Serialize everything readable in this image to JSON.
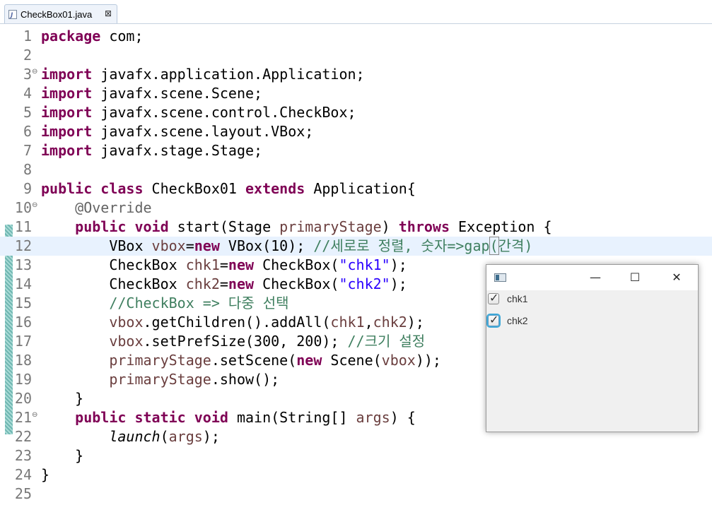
{
  "tab": {
    "title": "CheckBox01.java",
    "close": "⊠"
  },
  "editor": {
    "lines": [
      {
        "n": "1",
        "tokens": [
          {
            "t": "package",
            "c": "kw"
          },
          {
            "t": " com;"
          }
        ]
      },
      {
        "n": "2",
        "tokens": []
      },
      {
        "n": "3",
        "fold": "⊖",
        "tokens": [
          {
            "t": "import",
            "c": "kw"
          },
          {
            "t": " javafx.application.Application;"
          }
        ]
      },
      {
        "n": "4",
        "tokens": [
          {
            "t": "import",
            "c": "kw"
          },
          {
            "t": " javafx.scene.Scene;"
          }
        ]
      },
      {
        "n": "5",
        "tokens": [
          {
            "t": "import",
            "c": "kw"
          },
          {
            "t": " javafx.scene.control.CheckBox;"
          }
        ]
      },
      {
        "n": "6",
        "tokens": [
          {
            "t": "import",
            "c": "kw"
          },
          {
            "t": " javafx.scene.layout.VBox;"
          }
        ]
      },
      {
        "n": "7",
        "tokens": [
          {
            "t": "import",
            "c": "kw"
          },
          {
            "t": " javafx.stage.Stage;"
          }
        ]
      },
      {
        "n": "8",
        "tokens": []
      },
      {
        "n": "9",
        "tokens": [
          {
            "t": "public class",
            "c": "kw"
          },
          {
            "t": " CheckBox01 "
          },
          {
            "t": "extends",
            "c": "kw"
          },
          {
            "t": " Application{"
          }
        ]
      },
      {
        "n": "10",
        "fold": "⊖",
        "tokens": [
          {
            "t": "    "
          },
          {
            "t": "@Override",
            "c": "ann"
          }
        ]
      },
      {
        "n": "11",
        "tokens": [
          {
            "t": "    "
          },
          {
            "t": "public void",
            "c": "kw"
          },
          {
            "t": " start(Stage "
          },
          {
            "t": "primaryStage",
            "c": "var"
          },
          {
            "t": ") "
          },
          {
            "t": "throws",
            "c": "kw"
          },
          {
            "t": " Exception {"
          }
        ]
      },
      {
        "n": "12",
        "current": true,
        "tokens": [
          {
            "t": "        VBox "
          },
          {
            "t": "vbox",
            "c": "var"
          },
          {
            "t": "="
          },
          {
            "t": "new",
            "c": "kw"
          },
          {
            "t": " VBox(10); "
          },
          {
            "t": "//세로로 정렬, 숫자=>gap",
            "c": "cm"
          },
          {
            "t": "(",
            "c": "cm bracket"
          },
          {
            "t": "간격)",
            "c": "cm"
          }
        ]
      },
      {
        "n": "13",
        "tokens": [
          {
            "t": "        CheckBox "
          },
          {
            "t": "chk1",
            "c": "var"
          },
          {
            "t": "="
          },
          {
            "t": "new",
            "c": "kw"
          },
          {
            "t": " CheckBox("
          },
          {
            "t": "\"chk1\"",
            "c": "str"
          },
          {
            "t": ");"
          }
        ]
      },
      {
        "n": "14",
        "tokens": [
          {
            "t": "        CheckBox "
          },
          {
            "t": "chk2",
            "c": "var"
          },
          {
            "t": "="
          },
          {
            "t": "new",
            "c": "kw"
          },
          {
            "t": " CheckBox("
          },
          {
            "t": "\"chk2\"",
            "c": "str"
          },
          {
            "t": ");"
          }
        ]
      },
      {
        "n": "15",
        "tokens": [
          {
            "t": "        "
          },
          {
            "t": "//CheckBox => 다중 선택",
            "c": "cm"
          }
        ]
      },
      {
        "n": "16",
        "tokens": [
          {
            "t": "        "
          },
          {
            "t": "vbox",
            "c": "var"
          },
          {
            "t": ".getChildren().addAll("
          },
          {
            "t": "chk1",
            "c": "var"
          },
          {
            "t": ","
          },
          {
            "t": "chk2",
            "c": "var"
          },
          {
            "t": ");"
          }
        ]
      },
      {
        "n": "17",
        "tokens": [
          {
            "t": "        "
          },
          {
            "t": "vbox",
            "c": "var"
          },
          {
            "t": ".setPrefSize(300, 200); "
          },
          {
            "t": "//크기 설정",
            "c": "cm"
          }
        ]
      },
      {
        "n": "18",
        "tokens": [
          {
            "t": "        "
          },
          {
            "t": "primaryStage",
            "c": "var"
          },
          {
            "t": ".setScene("
          },
          {
            "t": "new",
            "c": "kw"
          },
          {
            "t": " Scene("
          },
          {
            "t": "vbox",
            "c": "var"
          },
          {
            "t": "));"
          }
        ]
      },
      {
        "n": "19",
        "tokens": [
          {
            "t": "        "
          },
          {
            "t": "primaryStage",
            "c": "var"
          },
          {
            "t": ".show();"
          }
        ]
      },
      {
        "n": "20",
        "tokens": [
          {
            "t": "    }"
          }
        ]
      },
      {
        "n": "21",
        "fold": "⊖",
        "tokens": [
          {
            "t": "    "
          },
          {
            "t": "public static void",
            "c": "kw"
          },
          {
            "t": " main(String[] "
          },
          {
            "t": "args",
            "c": "var"
          },
          {
            "t": ") {"
          }
        ]
      },
      {
        "n": "22",
        "tokens": [
          {
            "t": "        "
          },
          {
            "t": "launch",
            "c": "it"
          },
          {
            "t": "("
          },
          {
            "t": "args",
            "c": "var"
          },
          {
            "t": ");"
          }
        ]
      },
      {
        "n": "23",
        "tokens": [
          {
            "t": "    }"
          }
        ]
      },
      {
        "n": "24",
        "tokens": [
          {
            "t": "}"
          }
        ]
      },
      {
        "n": "25",
        "tokens": []
      }
    ]
  },
  "fx_window": {
    "minimize": "—",
    "maximize": "☐",
    "close": "✕",
    "checkboxes": [
      {
        "label": "chk1",
        "checked": true,
        "focused": false
      },
      {
        "label": "chk2",
        "checked": true,
        "focused": true
      }
    ]
  }
}
